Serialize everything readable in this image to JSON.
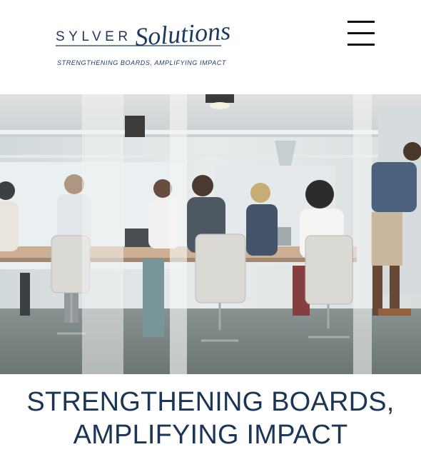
{
  "header": {
    "logo": {
      "wordmark_prefix": "SYLVER",
      "wordmark_script": "Solutions",
      "tagline": "STRENGTHENING BOARDS, AMPLIFYING IMPACT"
    },
    "menu_icon": "hamburger-menu-icon"
  },
  "hero": {
    "scene": "office-meeting-photo"
  },
  "headline": {
    "line1": "STRENGTHENING BOARDS,",
    "line2": "AMPLIFYING IMPACT"
  },
  "colors": {
    "brand_navy": "#1b3556",
    "menu_icon": "#111111",
    "background": "#ffffff"
  }
}
